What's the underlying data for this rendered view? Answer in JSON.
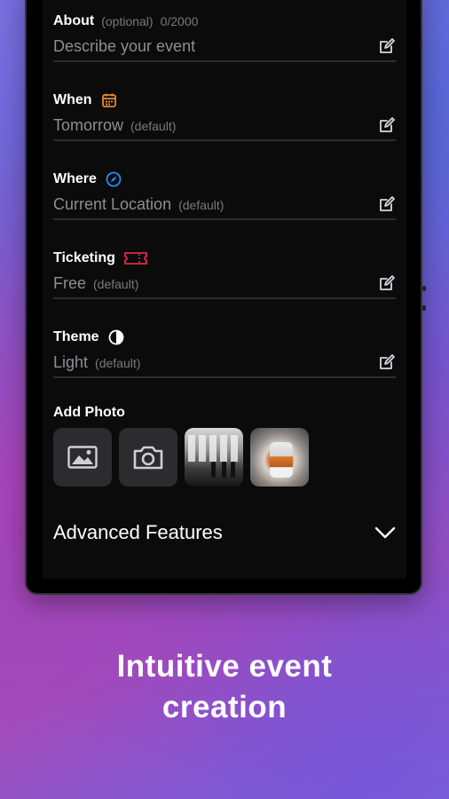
{
  "form": {
    "about": {
      "label": "About",
      "hint": "(optional)",
      "count": "0/2000",
      "placeholder": "Describe your event"
    },
    "when": {
      "label": "When",
      "value": "Tomorrow",
      "default": "(default)",
      "icon": "calendar-icon",
      "icon_color": "#e08a2a"
    },
    "where": {
      "label": "Where",
      "value": "Current Location",
      "default": "(default)",
      "icon": "compass-icon",
      "icon_color": "#1e90ff"
    },
    "ticketing": {
      "label": "Ticketing",
      "value": "Free",
      "default": "(default)",
      "icon": "ticket-icon",
      "icon_color": "#e0284a"
    },
    "theme": {
      "label": "Theme",
      "value": "Light",
      "default": "(default)",
      "icon": "contrast-icon"
    },
    "add_photo": {
      "label": "Add Photo"
    },
    "advanced": {
      "label": "Advanced Features"
    }
  },
  "tagline": {
    "line1": "Intuitive event",
    "line2": "creation"
  }
}
